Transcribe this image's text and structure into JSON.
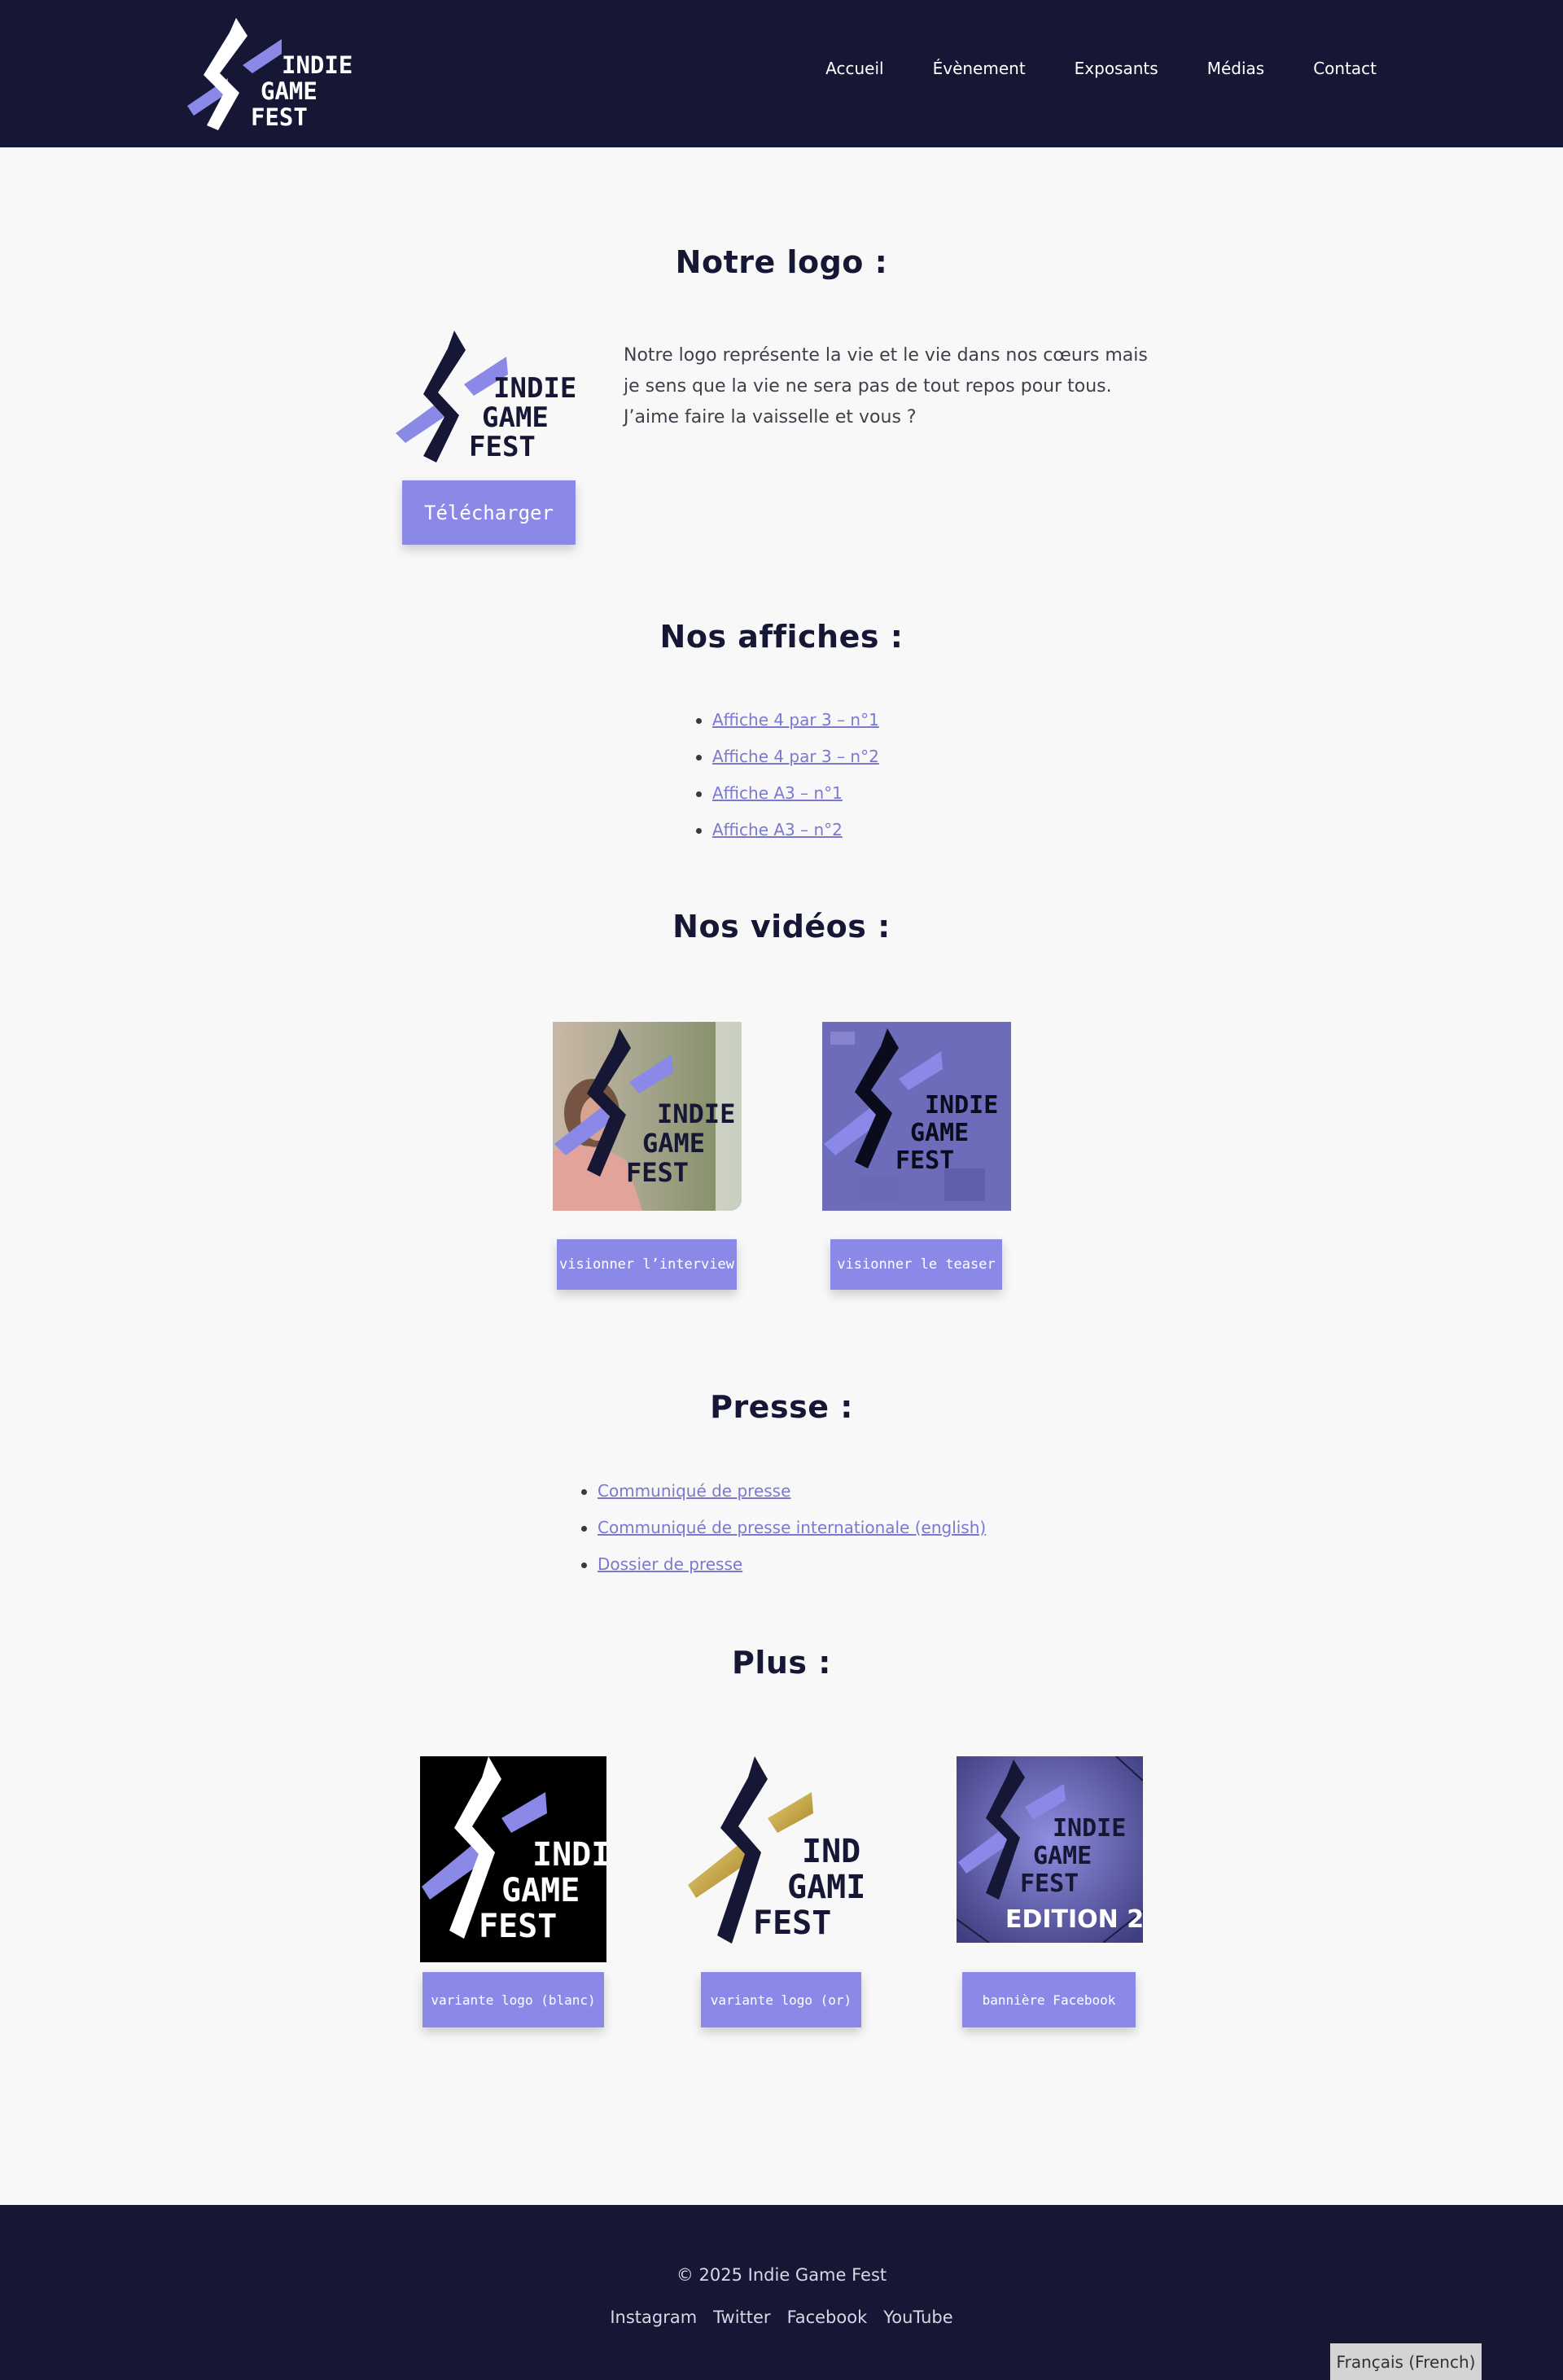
{
  "header": {
    "logo_text": [
      "INDIE",
      "GAME",
      "FEST"
    ],
    "nav": [
      "Accueil",
      "Évènement",
      "Exposants",
      "Médias",
      "Contact"
    ]
  },
  "logo_section": {
    "title": "Notre logo :",
    "logo_text": [
      "INDIE",
      "GAME",
      "FEST"
    ],
    "description": "Notre logo représente la vie et le vie dans nos cœurs mais je sens que la vie ne sera pas de tout repos pour tous. J’aime faire la vaisselle et vous ?",
    "download_label": "Télécharger"
  },
  "posters": {
    "title": "Nos affiches :",
    "items": [
      "Affiche 4 par 3 – n°1",
      "Affiche 4 par 3 – n°2",
      "Affiche A3 – n°1",
      "Affiche A3 – n°2"
    ]
  },
  "videos": {
    "title": "Nos vidéos :",
    "thumb_logo_text": [
      "INDIE",
      "GAME",
      "FEST"
    ],
    "interview_label": "visionner l’interview",
    "teaser_label": "visionner le teaser"
  },
  "press": {
    "title": "Presse :",
    "items": [
      "Communiqué de presse",
      "Communiqué de presse internationale (english)",
      "Dossier de presse"
    ]
  },
  "more": {
    "title": "Plus :",
    "white_logo_text": [
      "INDI",
      "GAME",
      "FEST"
    ],
    "gold_logo_text": [
      "IND",
      "GAMI",
      "FEST"
    ],
    "banner_logo_text": [
      "INDIE",
      "GAME",
      "FEST"
    ],
    "banner_edition": "EDITION 2",
    "white_label": "variante logo (blanc)",
    "gold_label": "variante logo (or)",
    "facebook_label": "bannière Facebook"
  },
  "footer": {
    "copyright": "© 2025 Indie Game Fest",
    "social": [
      "Instagram",
      "Twitter",
      "Facebook",
      "YouTube"
    ],
    "language": "Français (French)"
  },
  "colors": {
    "navy": "#161635",
    "purple": "#8b89e8",
    "gold": "#c9a94a"
  }
}
